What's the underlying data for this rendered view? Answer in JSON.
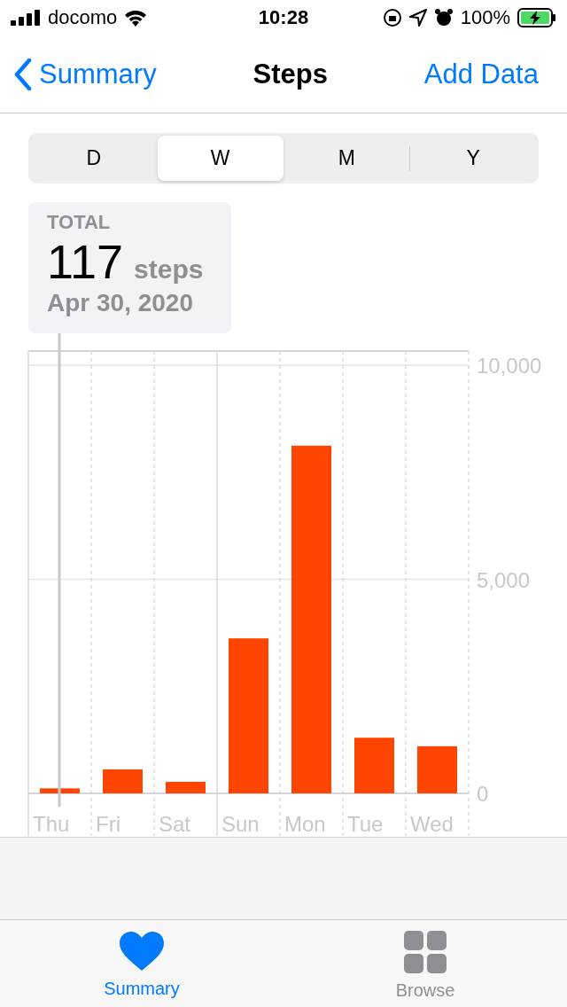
{
  "status_bar": {
    "carrier": "docomo",
    "time": "10:28",
    "battery": "100%"
  },
  "nav": {
    "back": "Summary",
    "title": "Steps",
    "action": "Add Data"
  },
  "segments": [
    {
      "label": "D",
      "selected": false
    },
    {
      "label": "W",
      "selected": true
    },
    {
      "label": "M",
      "selected": false
    },
    {
      "label": "Y",
      "selected": false
    }
  ],
  "callout": {
    "label": "TOTAL",
    "value": "117",
    "unit": "steps",
    "date": "Apr 30, 2020"
  },
  "chart_data": {
    "type": "bar",
    "categories": [
      "Thu",
      "Fri",
      "Sat",
      "Sun",
      "Mon",
      "Tue",
      "Wed"
    ],
    "series": [
      {
        "color": "#ff4500",
        "values": [
          117,
          560,
          270,
          3620,
          8120,
          1300,
          1100
        ]
      }
    ],
    "ylim": [
      0,
      10000
    ],
    "yticks": [
      {
        "value": 0,
        "label": "0"
      },
      {
        "value": 5000,
        "label": "5,000"
      },
      {
        "value": 10000,
        "label": "10,000"
      }
    ]
  },
  "tabs": [
    {
      "label": "Summary",
      "kind": "heart",
      "selected": true
    },
    {
      "label": "Browse",
      "kind": "grid",
      "selected": false
    }
  ]
}
